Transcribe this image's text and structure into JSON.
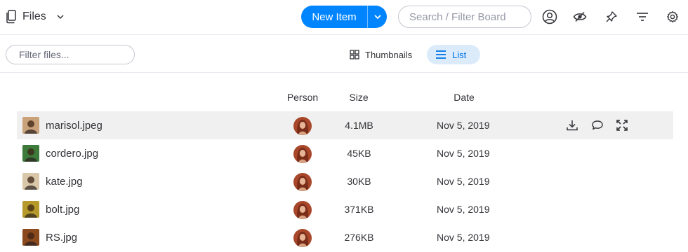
{
  "header": {
    "board_title": "Files",
    "new_item_label": "New Item",
    "search_placeholder": "Search / Filter Board",
    "tools": [
      "account-icon",
      "eye-off-icon",
      "pin-icon",
      "filter-icon",
      "settings-icon"
    ]
  },
  "toolbar": {
    "filter_placeholder": "Filter files...",
    "views": [
      {
        "label": "Thumbnails",
        "icon": "grid-icon",
        "active": false
      },
      {
        "label": "List",
        "icon": "list-icon",
        "active": true
      }
    ]
  },
  "table": {
    "columns": {
      "person": "Person",
      "size": "Size",
      "date": "Date"
    },
    "rows": [
      {
        "name": "marisol.jpeg",
        "size": "4.1MB",
        "date": "Nov 5, 2019",
        "thumb_color": "#c9a27a"
      },
      {
        "name": "cordero.jpg",
        "size": "45KB",
        "date": "Nov 5, 2019",
        "thumb_color": "#3e7a3a"
      },
      {
        "name": "kate.jpg",
        "size": "30KB",
        "date": "Nov 5, 2019",
        "thumb_color": "#d8c7a8"
      },
      {
        "name": "bolt.jpg",
        "size": "371KB",
        "date": "Nov 5, 2019",
        "thumb_color": "#b59a2b"
      },
      {
        "name": "RS.jpg",
        "size": "276KB",
        "date": "Nov 5, 2019",
        "thumb_color": "#8a4a1e"
      }
    ],
    "row_actions": [
      "download-icon",
      "comment-icon",
      "expand-icon"
    ]
  },
  "colors": {
    "accent": "#0085ff",
    "active_view_bg": "#dcebfa",
    "active_view_text": "#0073ea",
    "hover_row": "#f0f0f0"
  }
}
